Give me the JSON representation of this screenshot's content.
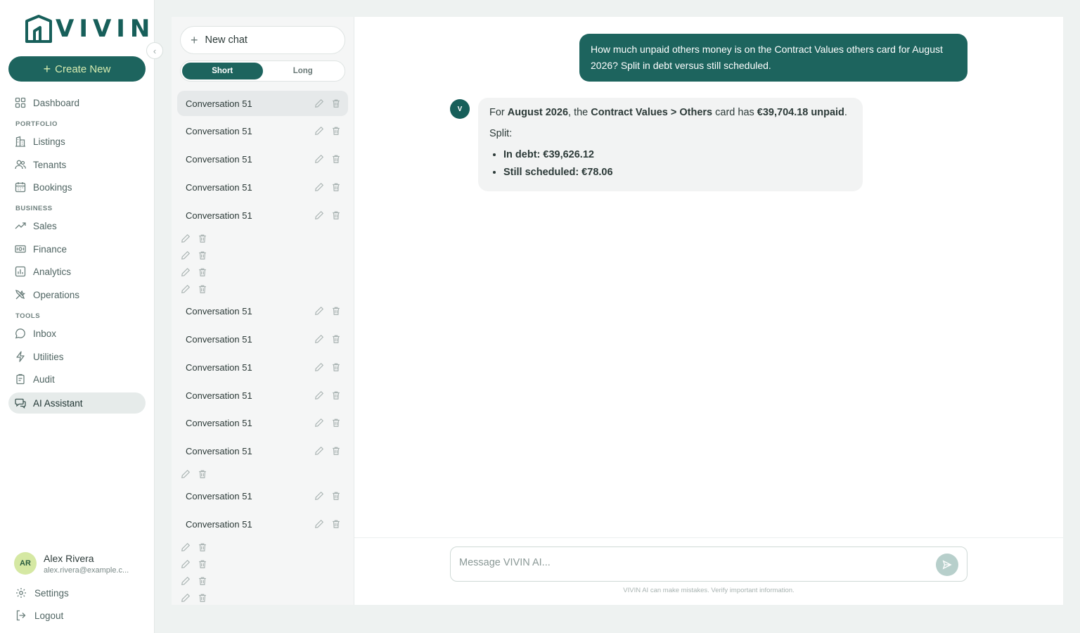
{
  "brand": {
    "logo_text": "VIVIN"
  },
  "sidebar": {
    "create_label": "Create New",
    "dashboard": "Dashboard",
    "sections": {
      "portfolio": "PORTFOLIO",
      "business": "BUSINESS",
      "tools": "TOOLS"
    },
    "items": {
      "listings": "Listings",
      "tenants": "Tenants",
      "bookings": "Bookings",
      "sales": "Sales",
      "finance": "Finance",
      "analytics": "Analytics",
      "operations": "Operations",
      "inbox": "Inbox",
      "utilities": "Utilities",
      "audit": "Audit",
      "ai_assistant": "AI Assistant"
    },
    "user": {
      "initials": "AR",
      "name": "Alex Rivera",
      "email": "alex.rivera@example.c..."
    },
    "settings": "Settings",
    "logout": "Logout"
  },
  "conversations": {
    "new_chat": "New chat",
    "modes": {
      "short": "Short",
      "long": "Long",
      "selected": "Short"
    },
    "items": [
      "Conversation 51",
      "Conversation 51",
      "Conversation 51",
      "Conversation 51",
      "Conversation 51",
      "Conversation 51",
      "Conversation 51",
      "Conversation 51",
      "Conversation 51",
      "Conversation 51",
      "Conversation 51",
      "Conversation 51",
      "Conversation 51"
    ]
  },
  "chat": {
    "user_message": "How much unpaid others money is on the Contract Values others card for August 2026? Split in debt versus still scheduled.",
    "bot_initial": "V",
    "answer": {
      "prefix": "For ",
      "period": "August 2026",
      "mid": ", the ",
      "card": "Contract Values > Others",
      "mid2": " card has ",
      "amount": "€39,704.18 unpaid",
      "suffix": ".",
      "split_label": "Split:",
      "bullets": [
        "In debt: €39,626.12",
        "Still scheduled: €78.06"
      ]
    },
    "input_placeholder": "Message VIVIN AI...",
    "input_value": "",
    "disclaimer": "VIVIN AI can make mistakes. Verify important information."
  },
  "colors": {
    "accent": "#1d645e",
    "accent_text": "#d6ecb0",
    "avatar_bg": "#d5e8a3"
  }
}
